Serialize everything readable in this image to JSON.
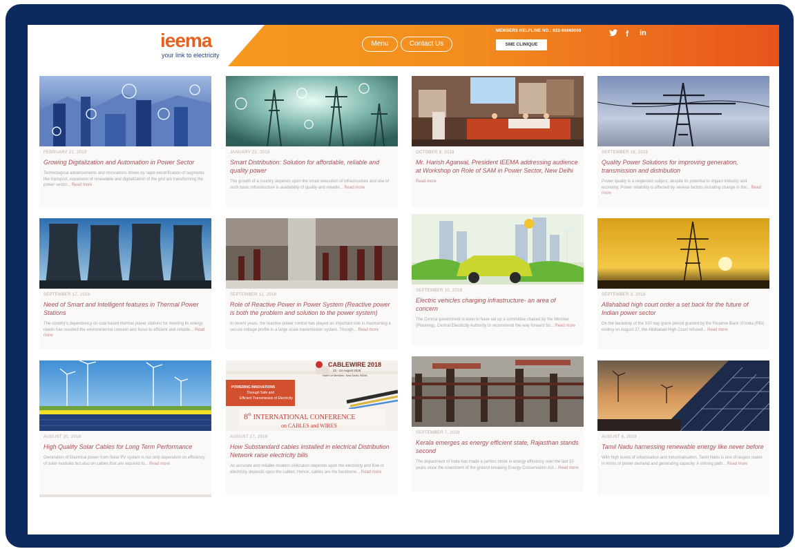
{
  "header": {
    "logo_text": "ieema",
    "logo_tagline": "your link to electricity",
    "menu_label": "Menu",
    "contact_label": "Contact Us",
    "helpline_label": "MEMBERS HELPLINE NO.: 022-66660000",
    "sme_label": "SME CLINIQUE",
    "social": [
      {
        "name": "twitter",
        "glyph": "🐦"
      },
      {
        "name": "facebook",
        "glyph": "f"
      },
      {
        "name": "linkedin",
        "glyph": "in"
      }
    ]
  },
  "colors": {
    "frame": "#0c2a5e",
    "header_orange": "#f28c1e",
    "header_red": "#e8531c",
    "title_color": "#a54e57"
  },
  "articles": [
    {
      "date": "FEBRUARY 21, 2019",
      "title": "Growing Digitalization and Automation in Power Sector",
      "excerpt": "Technological advancements and innovations driven by rapid electrification of segments like transport, expansion of renewable and digitalization of the grid are transforming the power sector...",
      "read_more": "Read more",
      "image": "digital-city"
    },
    {
      "date": "JANUARY 22, 2019",
      "title": "Smart Distribution: Solution for affordable, reliable and quality power",
      "excerpt": "The growth of a country depends upon the smart execution of infrastructure and one of such basic infrastructure is availability of quality and reliable...",
      "read_more": "Read more",
      "image": "smart-grid-towers"
    },
    {
      "date": "OCTOBER 9, 2018",
      "title": "Mr. Harish Agarwal, President IEEMA addressing audience at Workshop on Role of SAM in Power Sector, New Delhi",
      "excerpt": "",
      "read_more": "Read more",
      "image": "conference-stage"
    },
    {
      "date": "SEPTEMBER 18, 2018",
      "title": "Quality Power Solutions for improving generation, transmission and distribution",
      "excerpt": "Power quality is a neglected subject, despite its potential to impact industry and economy. Power reliability is affected by several factors including change in the...",
      "read_more": "Read more",
      "image": "transmission-tower-sky"
    },
    {
      "date": "SEPTEMBER 17, 2018",
      "title": "Need of Smart and Intelligent features in Thermal Power Stations",
      "excerpt": "The country's dependency on coal based thermal power stations for meeting its energy needs has resulted the environmental concern and focus to efficient and reliable...",
      "read_more": "Read more",
      "image": "cooling-towers"
    },
    {
      "date": "SEPTEMBER 12, 2018",
      "title": "Role of Reactive Power in Power System (Reactive power is both the problem and solution to the power system)",
      "excerpt": "In recent years, the reactive power control has played an important role in maintaining a secure voltage profile in a large scale transmission system. Though...",
      "read_more": "Read more",
      "image": "substation-insulators"
    },
    {
      "date": "SEPTEMBER 10, 2018",
      "title": "Electric vehicles charging infrastructure- an area of concern",
      "excerpt": "The Central government is keen to have set up a committee chaired by the Member (Planning), Central Electricity Authority to recommend the way forward for...",
      "read_more": "Read more",
      "image": "electric-vehicle-city"
    },
    {
      "date": "SEPTEMBER 3, 2018",
      "title": "Allahabad high court order a set back for the future of Indian power sector",
      "excerpt": "On the backdrop of the 100 day grace period granted by the Reserve Bank of India (RBI) ending on August 27, the Allahabad High Court refused...",
      "read_more": "Read more",
      "image": "tower-sunset"
    },
    {
      "date": "AUGUST 20, 2018",
      "title": "High Quality Solar Cables for Long Term Performance",
      "excerpt": "Generation of Electrical power from Solar PV system is not only dependent on efficiency of solar modules but also on cables that are required to...",
      "read_more": "Read more",
      "image": "solar-wind-farm"
    },
    {
      "date": "AUGUST 17, 2018",
      "title": "How Substandard cables installed in electrical Distribution Network raise electricity bills",
      "excerpt": "An accurate and reliable modern civilization depends upon the electricity and flow of electricity depends upon the cables. Hence, cables are the backbone...",
      "read_more": "Read more",
      "image": "cables-conference",
      "poster": {
        "brand": "CABLEWIRE 2018",
        "dates": "23 - 24 August 2018",
        "venue": "Hotel Le Meridien, New Delhi, INDIA",
        "tagline_1": "POWERING INNOVATIONS",
        "tagline_2": "Through Safe and",
        "tagline_3": "Efficient Transmission of Electricity",
        "conference_num": "8",
        "conference_sup": "th",
        "conference_text": "INTERNATIONAL CONFERENCE",
        "conference_sub": "on CABLES and WIRES"
      }
    },
    {
      "date": "SEPTEMBER 7, 2018",
      "title": "Kerala emerges as energy efficient state, Rajasthan stands second",
      "excerpt": "The department of India has made a perfect stride in energy efficiency over the last 10 years since the enactment of the ground breaking Energy Conservation Act...",
      "read_more": "Read more",
      "image": "switchyard"
    },
    {
      "date": "AUGUST 6, 2018",
      "title": "Tamil Nadu harnessing renewable energy like never before",
      "excerpt": "With high levels of urbanisation and industrialisation, Tamil Nadu is one of largest states in terms of power demand and generating capacity. A shining path...",
      "read_more": "Read more",
      "image": "solar-panels-sunset"
    }
  ]
}
